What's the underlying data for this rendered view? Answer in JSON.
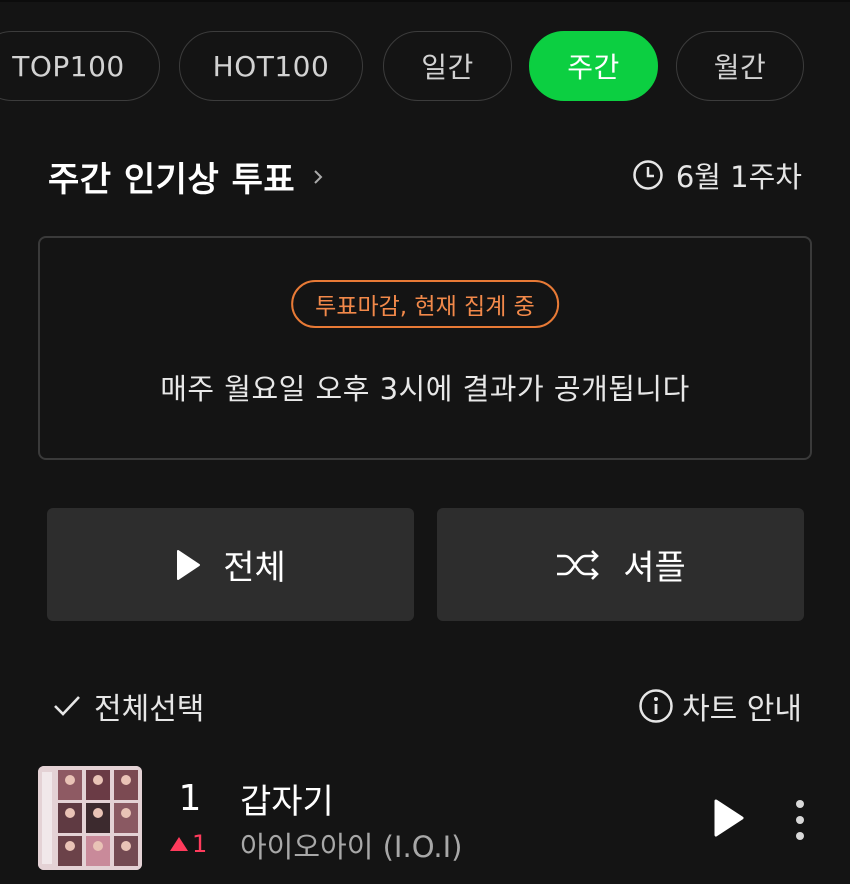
{
  "tabs": [
    {
      "label": "TOP100",
      "active": false
    },
    {
      "label": "HOT100",
      "active": false
    },
    {
      "label": "일간",
      "active": false
    },
    {
      "label": "주간",
      "active": true
    },
    {
      "label": "월간",
      "active": false
    }
  ],
  "header": {
    "title": "주간 인기상 투표",
    "week_label": "6월 1주차"
  },
  "notice": {
    "badge": "투표마감, 현재 집계 중",
    "text": "매주 월요일 오후 3시에 결과가 공개됩니다"
  },
  "actions": {
    "play_all": "전체",
    "shuffle": "셔플"
  },
  "list_controls": {
    "select_all": "전체선택",
    "chart_guide": "차트 안내"
  },
  "songs": [
    {
      "rank": "1",
      "rank_change": "1",
      "title": "갑자기",
      "artist": "아이오아이 (I.O.I)"
    }
  ],
  "colors": {
    "accent": "#0ccf41",
    "badge_orange": "#e87a36",
    "rank_up": "#ff3b5c",
    "background": "#141414"
  }
}
